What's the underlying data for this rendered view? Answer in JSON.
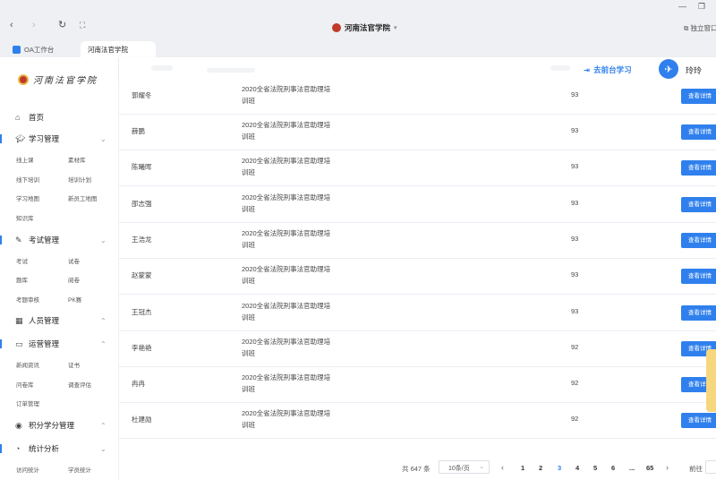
{
  "browser": {
    "nav": {
      "back": "‹",
      "forward": "›",
      "reload": "↻",
      "expand": "⛶"
    },
    "address_title": "河南法官学院",
    "standalone_label": "独立窗口",
    "tabs": [
      {
        "label": "OA工作台",
        "active": false
      },
      {
        "label": "河南法官学院",
        "active": true
      }
    ]
  },
  "sidebar": {
    "logo_text": "河南法官学院",
    "home": {
      "label": "首页",
      "icon": "home-icon"
    },
    "sections": [
      {
        "key": "study",
        "label": "学习管理",
        "icon": "graduation-cap-icon",
        "expanded": true,
        "items": [
          "线上课",
          "素材库",
          "线下培训",
          "培训计划",
          "学习地图",
          "新员工地图",
          "知识库"
        ]
      },
      {
        "key": "exam",
        "label": "考试管理",
        "icon": "exam-icon",
        "expanded": true,
        "items": [
          "考试",
          "试卷",
          "题库",
          "阅卷",
          "考题审核",
          "PK赛"
        ]
      },
      {
        "key": "people",
        "label": "人员管理",
        "icon": "people-icon",
        "expanded": false,
        "items": []
      },
      {
        "key": "ops",
        "label": "运营管理",
        "icon": "monitor-icon",
        "expanded": true,
        "items": [
          "新闻资讯",
          "证书",
          "问卷库",
          "调查评估",
          "订单管理"
        ]
      },
      {
        "key": "points",
        "label": "积分学分管理",
        "icon": "points-icon",
        "expanded": false,
        "items": []
      },
      {
        "key": "stats",
        "label": "统计分析",
        "icon": "chart-icon",
        "expanded": true,
        "items": [
          "访问统计",
          "学员统计"
        ]
      }
    ]
  },
  "header": {
    "front_desk_label": "去前台学习",
    "username": "玲玲"
  },
  "table": {
    "button_label": "查看详情",
    "rows": [
      {
        "name": "郭耀冬",
        "class_line1": "2020全省法院刑事法官助理培",
        "class_line2": "训班",
        "score": "93"
      },
      {
        "name": "薛鹏",
        "class_line1": "2020全省法院刑事法官助理培",
        "class_line2": "训班",
        "score": "93"
      },
      {
        "name": "陈曦晖",
        "class_line1": "2020全省法院刑事法官助理培",
        "class_line2": "训班",
        "score": "93"
      },
      {
        "name": "邵志强",
        "class_line1": "2020全省法院刑事法官助理培",
        "class_line2": "训班",
        "score": "93"
      },
      {
        "name": "王浩龙",
        "class_line1": "2020全省法院刑事法官助理培",
        "class_line2": "训班",
        "score": "93"
      },
      {
        "name": "赵蒙蒙",
        "class_line1": "2020全省法院刑事法官助理培",
        "class_line2": "训班",
        "score": "93"
      },
      {
        "name": "王冠杰",
        "class_line1": "2020全省法院刑事法官助理培",
        "class_line2": "训班",
        "score": "93"
      },
      {
        "name": "李艳艳",
        "class_line1": "2020全省法院刑事法官助理培",
        "class_line2": "训班",
        "score": "92"
      },
      {
        "name": "冉冉",
        "class_line1": "2020全省法院刑事法官助理培",
        "class_line2": "训班",
        "score": "92"
      },
      {
        "name": "杜建勋",
        "class_line1": "2020全省法院刑事法官助理培",
        "class_line2": "训班",
        "score": "92"
      }
    ]
  },
  "pagination": {
    "total": "共 647 条",
    "page_size": "10条/页",
    "prev": "‹",
    "next": "›",
    "pages": [
      "1",
      "2",
      "3",
      "4",
      "5",
      "6",
      "...",
      "65"
    ],
    "current_page": "3",
    "goto_label": "前往"
  },
  "colors": {
    "accent": "#2f80ed",
    "float_tab": "#f6d77d"
  }
}
